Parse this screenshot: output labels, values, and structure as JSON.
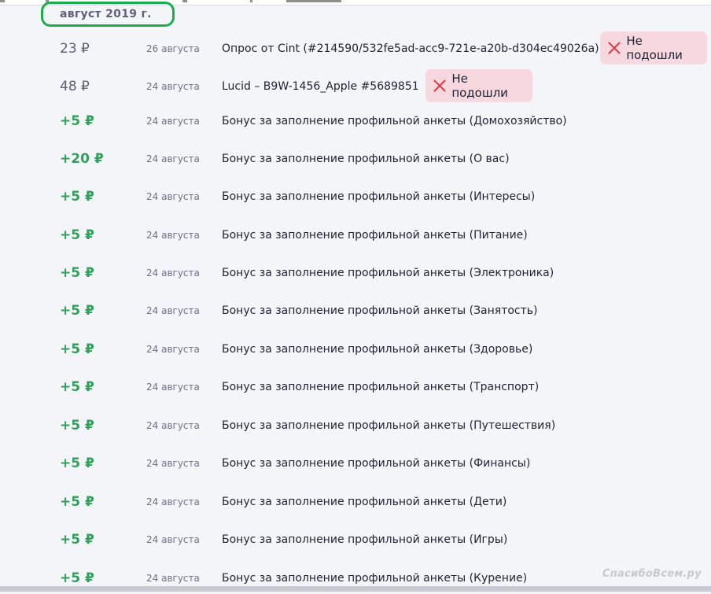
{
  "month": {
    "label": "август 2019 г."
  },
  "rows": [
    {
      "amount": "23 ₽",
      "kind": "neg",
      "date": "26 августа",
      "desc": "Опрос от Cint (#214590/532fe5ad-acc9-721e-a20b-d304ec49026a)",
      "status": "Не подошли"
    },
    {
      "amount": "48 ₽",
      "kind": "neg",
      "date": "24 августа",
      "desc": "Lucid – B9W-1456_Apple #5689851",
      "status": "Не подошли"
    },
    {
      "amount": "+5 ₽",
      "kind": "pos",
      "date": "24 августа",
      "desc": "Бонус за заполнение профильной анкеты (Домохозяйство)"
    },
    {
      "amount": "+20 ₽",
      "kind": "pos",
      "date": "24 августа",
      "desc": "Бонус за заполнение профильной анкеты (О вас)"
    },
    {
      "amount": "+5 ₽",
      "kind": "pos",
      "date": "24 августа",
      "desc": "Бонус за заполнение профильной анкеты (Интересы)"
    },
    {
      "amount": "+5 ₽",
      "kind": "pos",
      "date": "24 августа",
      "desc": "Бонус за заполнение профильной анкеты (Питание)"
    },
    {
      "amount": "+5 ₽",
      "kind": "pos",
      "date": "24 августа",
      "desc": "Бонус за заполнение профильной анкеты (Электроника)"
    },
    {
      "amount": "+5 ₽",
      "kind": "pos",
      "date": "24 августа",
      "desc": "Бонус за заполнение профильной анкеты (Занятость)"
    },
    {
      "amount": "+5 ₽",
      "kind": "pos",
      "date": "24 августа",
      "desc": "Бонус за заполнение профильной анкеты (Здоровье)"
    },
    {
      "amount": "+5 ₽",
      "kind": "pos",
      "date": "24 августа",
      "desc": "Бонус за заполнение профильной анкеты (Транспорт)"
    },
    {
      "amount": "+5 ₽",
      "kind": "pos",
      "date": "24 августа",
      "desc": "Бонус за заполнение профильной анкеты (Путешествия)"
    },
    {
      "amount": "+5 ₽",
      "kind": "pos",
      "date": "24 августа",
      "desc": "Бонус за заполнение профильной анкеты (Финансы)"
    },
    {
      "amount": "+5 ₽",
      "kind": "pos",
      "date": "24 августа",
      "desc": "Бонус за заполнение профильной анкеты (Дети)"
    },
    {
      "amount": "+5 ₽",
      "kind": "pos",
      "date": "24 августа",
      "desc": "Бонус за заполнение профильной анкеты (Игры)"
    },
    {
      "amount": "+5 ₽",
      "kind": "pos",
      "date": "24 августа",
      "desc": "Бонус за заполнение профильной анкеты (Курение)"
    }
  ],
  "watermark": "СпасибоВсем.ру",
  "colors": {
    "positive": "#2fa15a",
    "neutral": "#5b6178",
    "status_bg": "#f6d8de",
    "status_icon": "#e5323f",
    "highlight": "#1aad4b"
  }
}
